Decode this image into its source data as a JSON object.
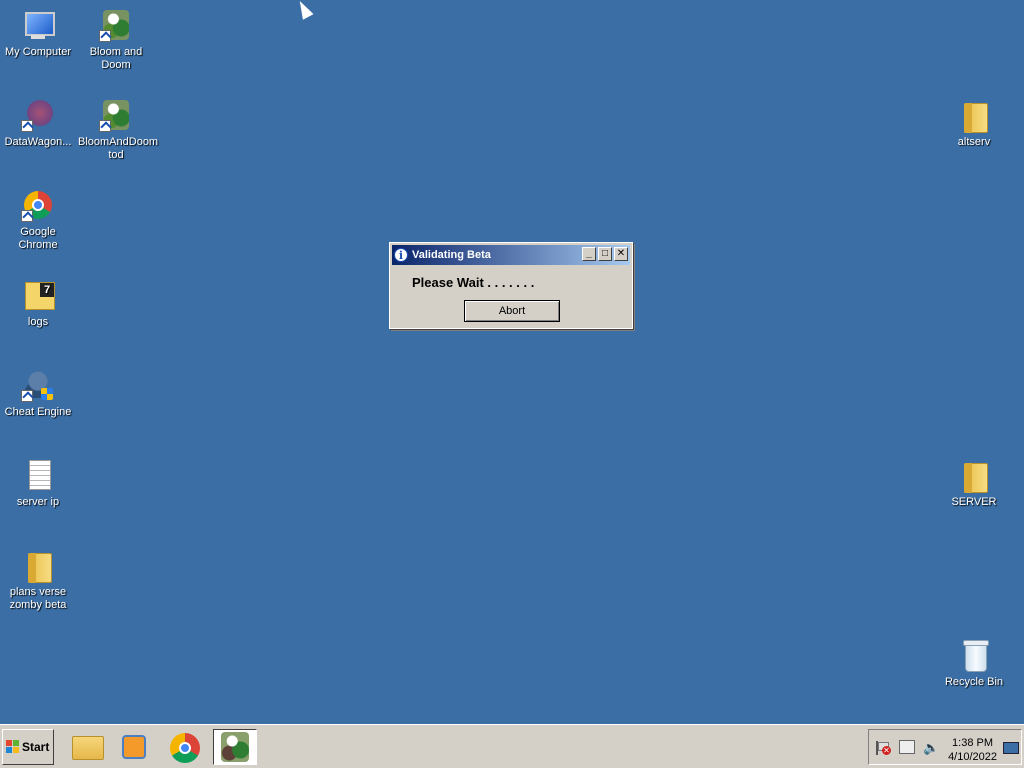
{
  "desktop": {
    "icons_left": [
      {
        "label": "My Computer",
        "icon": "my-computer-icon"
      },
      {
        "label": "Bloom and Doom",
        "icon": "bloom-and-doom-icon"
      },
      {
        "label": "DataWagon...",
        "icon": "datawagon-icon"
      },
      {
        "label": "BloomAndDoom tod",
        "icon": "bloomanddoom-tod-icon"
      },
      {
        "label": "Google Chrome",
        "icon": "chrome-icon"
      },
      {
        "label": "logs",
        "icon": "folder-icon"
      },
      {
        "label": "Cheat Engine",
        "icon": "cheat-engine-icon"
      },
      {
        "label": "server ip",
        "icon": "text-file-icon"
      },
      {
        "label": "plans verse zomby beta",
        "icon": "folder-icon"
      }
    ],
    "icons_right": [
      {
        "label": "altserv",
        "icon": "folder-icon"
      },
      {
        "label": "SERVER",
        "icon": "folder-icon"
      },
      {
        "label": "Recycle Bin",
        "icon": "recycle-bin-icon"
      }
    ],
    "background_color": "#3b6ea5"
  },
  "dialog": {
    "title": "Validating Beta",
    "message": "Please Wait . . . . . . .",
    "abort_label": "Abort",
    "minimize_glyph": "_",
    "maximize_glyph": "□",
    "close_glyph": "✕",
    "info_glyph": "i"
  },
  "taskbar": {
    "start_label": "Start",
    "clock_time": "1:38 PM",
    "clock_date": "4/10/2022"
  }
}
